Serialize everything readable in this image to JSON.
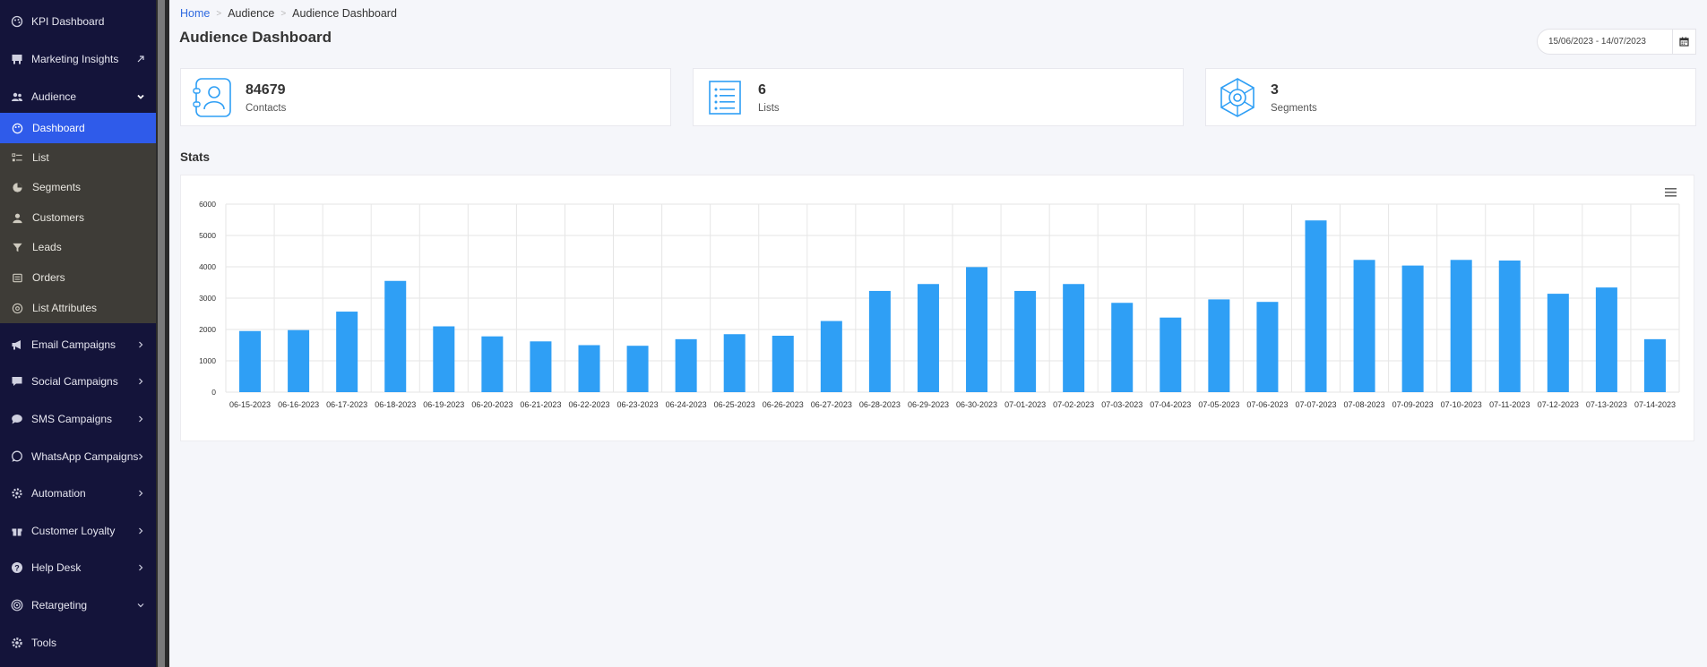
{
  "sidebar": {
    "items": [
      {
        "label": "KPI Dashboard",
        "icon": "palette-icon"
      },
      {
        "label": "Marketing Insights",
        "icon": "chalkboard-icon"
      },
      {
        "label": "Audience",
        "icon": "users-icon"
      },
      {
        "label": "Email Campaigns",
        "icon": "megaphone-icon"
      },
      {
        "label": "Social Campaigns",
        "icon": "comment-icon"
      },
      {
        "label": "SMS Campaigns",
        "icon": "chat-icon"
      },
      {
        "label": "WhatsApp Campaigns",
        "icon": "whatsapp-icon"
      },
      {
        "label": "Automation",
        "icon": "gear-icon"
      },
      {
        "label": "Customer Loyalty",
        "icon": "gift-icon"
      },
      {
        "label": "Help Desk",
        "icon": "question-icon"
      },
      {
        "label": "Retargeting",
        "icon": "target-icon"
      },
      {
        "label": "Tools",
        "icon": "cog-icon"
      }
    ],
    "audience_sub": [
      {
        "label": "Dashboard",
        "icon": "palette-icon"
      },
      {
        "label": "List",
        "icon": "list-icon"
      },
      {
        "label": "Segments",
        "icon": "pie-icon"
      },
      {
        "label": "Customers",
        "icon": "user-icon"
      },
      {
        "label": "Leads",
        "icon": "funnel-icon"
      },
      {
        "label": "Orders",
        "icon": "cart-icon"
      },
      {
        "label": "List Attributes",
        "icon": "sliders-icon"
      }
    ]
  },
  "breadcrumb": {
    "home": "Home",
    "parent": "Audience",
    "current": "Audience Dashboard"
  },
  "page_title": "Audience Dashboard",
  "date_range": "15/06/2023 - 14/07/2023",
  "cards": [
    {
      "value": "84679",
      "label": "Contacts",
      "icon": "contacts-book-icon"
    },
    {
      "value": "6",
      "label": "Lists",
      "icon": "list-icon"
    },
    {
      "value": "3",
      "label": "Segments",
      "icon": "hexagon-segment-icon"
    }
  ],
  "stats_heading": "Stats",
  "colors": {
    "bar": "#2f9ff5",
    "sidebar": "#14143a",
    "active": "#2f5bea",
    "accent": "#2f6ae0"
  },
  "chart_data": {
    "type": "bar",
    "categories": [
      "06-15-2023",
      "06-16-2023",
      "06-17-2023",
      "06-18-2023",
      "06-19-2023",
      "06-20-2023",
      "06-21-2023",
      "06-22-2023",
      "06-23-2023",
      "06-24-2023",
      "06-25-2023",
      "06-26-2023",
      "06-27-2023",
      "06-28-2023",
      "06-29-2023",
      "06-30-2023",
      "07-01-2023",
      "07-02-2023",
      "07-03-2023",
      "07-04-2023",
      "07-05-2023",
      "07-06-2023",
      "07-07-2023",
      "07-08-2023",
      "07-09-2023",
      "07-10-2023",
      "07-11-2023",
      "07-12-2023",
      "07-13-2023",
      "07-14-2023"
    ],
    "values": [
      1950,
      1980,
      2570,
      3550,
      2100,
      1780,
      1620,
      1500,
      1480,
      1690,
      1850,
      1800,
      2270,
      3230,
      3450,
      3990,
      3230,
      3450,
      2850,
      2380,
      2960,
      2880,
      5480,
      4220,
      4040,
      4220,
      4200,
      3140,
      3340,
      1690
    ],
    "ylim": [
      0,
      6000
    ],
    "yticks": [
      "0",
      "1000",
      "2000",
      "3000",
      "4000",
      "5000",
      "6000"
    ],
    "grid": true,
    "legend": "none"
  }
}
